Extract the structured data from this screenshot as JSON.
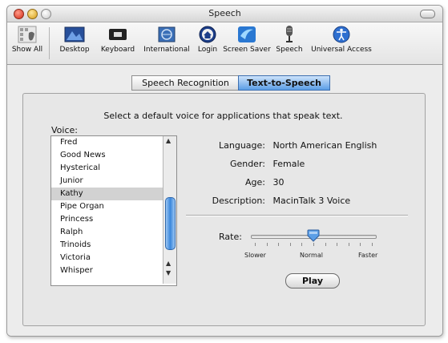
{
  "window": {
    "title": "Speech"
  },
  "toolbar": {
    "items": [
      {
        "label": "Show All",
        "icon": "apple-grid-icon"
      },
      {
        "label": "Desktop",
        "icon": "desktop-icon"
      },
      {
        "label": "Keyboard",
        "icon": "keyboard-icon"
      },
      {
        "label": "International",
        "icon": "flag-icon"
      },
      {
        "label": "Login",
        "icon": "login-house-icon"
      },
      {
        "label": "Screen Saver",
        "icon": "screensaver-icon"
      },
      {
        "label": "Speech",
        "icon": "microphone-icon"
      },
      {
        "label": "Universal Access",
        "icon": "universal-access-icon"
      }
    ]
  },
  "tabs": [
    {
      "label": "Speech Recognition",
      "active": false
    },
    {
      "label": "Text-to-Speech",
      "active": true
    }
  ],
  "panel": {
    "prompt": "Select a default voice for applications that speak text.",
    "voice_label": "Voice:",
    "voices": [
      "Fred",
      "Good News",
      "Hysterical",
      "Junior",
      "Kathy",
      "Pipe Organ",
      "Princess",
      "Ralph",
      "Trinoids",
      "Victoria",
      "Whisper"
    ],
    "selected_voice": "Kathy"
  },
  "details": {
    "language_label": "Language:",
    "language_value": "North American English",
    "gender_label": "Gender:",
    "gender_value": "Female",
    "age_label": "Age:",
    "age_value": "30",
    "description_label": "Description:",
    "description_value": "MacinTalk 3 Voice"
  },
  "rate": {
    "label": "Rate:",
    "slower": "Slower",
    "normal": "Normal",
    "faster": "Faster",
    "value_fraction": 0.5
  },
  "play_button": {
    "label": "Play"
  },
  "colors": {
    "accent": "#5b9ee6",
    "selection": "#d2d2d2"
  }
}
